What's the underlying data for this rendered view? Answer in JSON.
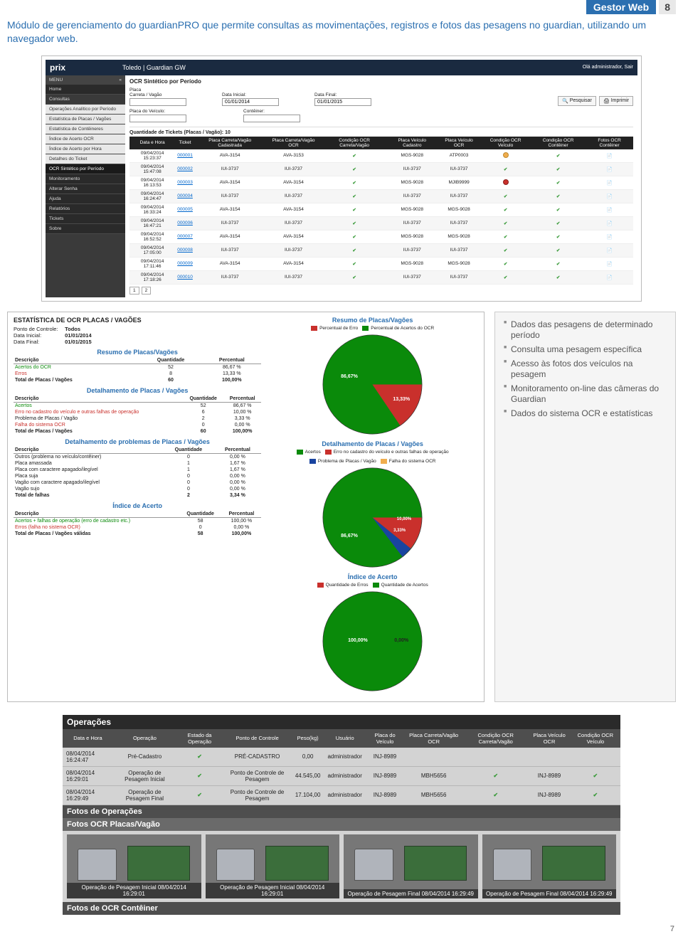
{
  "header": {
    "title": "Gestor Web",
    "page": "8"
  },
  "intro": "Módulo de gerenciamento do guardianPRO que permite consultas as movimentações, registros e fotos das pesagens no guardian, utilizando um navegador web.",
  "app": {
    "logo": "prix",
    "title": "Toledo | Guardian GW",
    "greeting": "Olá administrador, Sair",
    "menu_label": "MENU",
    "menu_collapse": "«",
    "sidebar": [
      "Home",
      "Consultas",
      "Operações Analítico por Período",
      "Estatística de Placas / Vagões",
      "Estatística de Contêineres",
      "Índice de Acerto OCR",
      "Índice de Acerto por Hora",
      "Detalhes do Ticket",
      "OCR Sintético por Período",
      "Monitoramento",
      "Alterar Senha",
      "Ajuda",
      "Relatórios",
      "Tickets",
      "Sobre"
    ],
    "main_title": "OCR Sintético por Período",
    "filters": {
      "f1_label": "Placa\nCarreta / Vagão",
      "f2_label": "Data Inicial:",
      "f2_value": "01/01/2014",
      "f3_label": "Data Final:",
      "f3_value": "01/01/2015",
      "f4_label": "Placa do Veículo:",
      "f5_label": "Contêiner:",
      "btn_search": "Pesquisar",
      "btn_print": "Imprimir"
    },
    "qty_line": "Quantidade de Tickets (Placas / Vagão): 10",
    "table": {
      "headers": [
        "Data e Hora",
        "Ticket",
        "Placa Carreta/Vagão Cadastrada",
        "Placa Carreta/Vagão OCR",
        "Condição OCR Carreta/Vagão",
        "Placa Veículo Cadastro",
        "Placa Veículo OCR",
        "Condição OCR Veículo",
        "Condição OCR Contêiner",
        "Fotos OCR Contêiner"
      ],
      "rows": [
        [
          "09/04/2014 15:23:37",
          "000001",
          "AVA-3154",
          "AVA-3153",
          "chk",
          "MGS-9028",
          "ATP0003",
          "warn",
          "chk",
          "doc"
        ],
        [
          "09/04/2014 15:47:08",
          "000002",
          "IUI-3737",
          "IUI-3737",
          "chk",
          "IUI-3737",
          "IUI-3737",
          "chk",
          "chk",
          "doc"
        ],
        [
          "09/04/2014 16:13:53",
          "000003",
          "AVA-3154",
          "AVA-3154",
          "chk",
          "MGS-9028",
          "MJIB9999",
          "err",
          "chk",
          "doc"
        ],
        [
          "09/04/2014 16:24:47",
          "000004",
          "IUI-3737",
          "IUI-3737",
          "chk",
          "IUI-3737",
          "IUI-3737",
          "chk",
          "chk",
          "doc"
        ],
        [
          "09/04/2014 16:33:24",
          "000005",
          "AVA-3154",
          "AVA-3154",
          "chk",
          "MGS-9028",
          "MGS-9028",
          "chk",
          "chk",
          "doc"
        ],
        [
          "09/04/2014 16:47:21",
          "000006",
          "IUI-3737",
          "IUI-3737",
          "chk",
          "IUI-3737",
          "IUI-3737",
          "chk",
          "chk",
          "doc"
        ],
        [
          "09/04/2014 16:52:52",
          "000007",
          "AVA-3154",
          "AVA-3154",
          "chk",
          "MGS-9028",
          "MGS-9028",
          "chk",
          "chk",
          "doc"
        ],
        [
          "09/04/2014 17:05:00",
          "000008",
          "IUI-3737",
          "IUI-3737",
          "chk",
          "IUI-3737",
          "IUI-3737",
          "chk",
          "chk",
          "doc"
        ],
        [
          "09/04/2014 17:11:46",
          "000009",
          "AVA-3154",
          "AVA-3154",
          "chk",
          "MGS-9028",
          "MGS-9028",
          "chk",
          "chk",
          "doc"
        ],
        [
          "09/04/2014 17:18:26",
          "000010",
          "IUI-3737",
          "IUI-3737",
          "chk",
          "IUI-3737",
          "IUI-3737",
          "chk",
          "chk",
          "doc"
        ]
      ]
    },
    "pager": [
      "1",
      "2"
    ]
  },
  "stats": {
    "title": "ESTATÍSTICA DE OCR PLACAS / VAGÕES",
    "meta": {
      "l1k": "Ponto de Controle:",
      "l1v": "Todos",
      "l2k": "Data Inicial:",
      "l2v": "01/01/2014",
      "l3k": "Data Final:",
      "l3v": "01/01/2015"
    },
    "sec1": {
      "title": "Resumo de Placas/Vagões",
      "cols": [
        "Descrição",
        "Quantidade",
        "Percentual"
      ],
      "rows": [
        {
          "d": "Acertos do OCR",
          "q": "52",
          "p": "86,67 %",
          "cls": "green"
        },
        {
          "d": "Erros",
          "q": "8",
          "p": "13,33 %",
          "cls": "red"
        },
        {
          "d": "Total de Placas / Vagões",
          "q": "60",
          "p": "100,00%",
          "cls": "bold"
        }
      ]
    },
    "sec2": {
      "title": "Detalhamento de Placas / Vagões",
      "cols": [
        "Descrição",
        "Quantidade",
        "Percentual"
      ],
      "rows": [
        {
          "d": "Acertos",
          "q": "52",
          "p": "86,67 %",
          "cls": "green"
        },
        {
          "d": "Erro no cadastro do veículo e outras falhas de operação",
          "q": "6",
          "p": "10,00 %",
          "cls": "red"
        },
        {
          "d": "Problema de Placas / Vagão",
          "q": "2",
          "p": "3,33 %",
          "cls": ""
        },
        {
          "d": "Falha do sistema OCR",
          "q": "0",
          "p": "0,00 %",
          "cls": "red"
        },
        {
          "d": "Total de Placas / Vagões",
          "q": "60",
          "p": "100,00%",
          "cls": "bold"
        }
      ]
    },
    "sec3": {
      "title": "Detalhamento de problemas de Placas / Vagões",
      "cols": [
        "Descrição",
        "Quantidade",
        "Percentual"
      ],
      "rows": [
        {
          "d": "Outros (problema no veículo/contêiner)",
          "q": "0",
          "p": "0,00 %",
          "cls": ""
        },
        {
          "d": "Placa amassada",
          "q": "1",
          "p": "1,67 %",
          "cls": ""
        },
        {
          "d": "Placa com caractere apagado/ilegível",
          "q": "1",
          "p": "1,67 %",
          "cls": ""
        },
        {
          "d": "Placa suja",
          "q": "0",
          "p": "0,00 %",
          "cls": ""
        },
        {
          "d": "Vagão com caractere apagado/ilegível",
          "q": "0",
          "p": "0,00 %",
          "cls": ""
        },
        {
          "d": "Vagão sujo",
          "q": "0",
          "p": "0,00 %",
          "cls": ""
        },
        {
          "d": "Total de falhas",
          "q": "2",
          "p": "3,34 %",
          "cls": "bold"
        }
      ]
    },
    "sec4": {
      "title": "Índice de Acerto",
      "cols": [
        "Descrição",
        "Quantidade",
        "Percentual"
      ],
      "rows": [
        {
          "d": "Acertos + falhas de operação (erro de cadastro etc.)",
          "q": "58",
          "p": "100,00 %",
          "cls": "green"
        },
        {
          "d": "Erros (falha no sistema OCR)",
          "q": "0",
          "p": "0,00 %",
          "cls": "red"
        },
        {
          "d": "Total de Placas / Vagões válidas",
          "q": "58",
          "p": "100,00%",
          "cls": "bold"
        }
      ]
    },
    "charts": {
      "c1": {
        "title": "Resumo de Placas/Vagões",
        "legend": [
          {
            "c": "#c9302c",
            "t": "Percentual de Erro"
          },
          {
            "c": "#0a8a0a",
            "t": "Percentual de Acertos do OCR"
          }
        ],
        "labels": [
          "86,67%",
          "13,33%"
        ]
      },
      "c2": {
        "title": "Detalhamento de Placas / Vagões",
        "legend": [
          {
            "c": "#0a8a0a",
            "t": "Acertos"
          },
          {
            "c": "#c9302c",
            "t": "Erro no cadastro do veículo e outras falhas de operação"
          },
          {
            "c": "#1944a0",
            "t": "Problema de Placas / Vagão"
          },
          {
            "c": "#f0ad4e",
            "t": "Falha do sistema OCR"
          }
        ],
        "labels": [
          "86,67%",
          "3,33%",
          "10,00%"
        ]
      },
      "c3": {
        "title": "Índice de Acerto",
        "legend": [
          {
            "c": "#c9302c",
            "t": "Quantidade de Erros"
          },
          {
            "c": "#0a8a0a",
            "t": "Quantidade de Acertos"
          }
        ],
        "labels": [
          "100,00%",
          "0,00%"
        ]
      }
    }
  },
  "features": [
    "Dados das pesagens de determinado período",
    "Consulta uma pesagem específica",
    "Acesso às fotos dos veículos na pesagem",
    "Monitoramento on-line das câmeras do Guardian",
    "Dados do sistema OCR e estatísticas"
  ],
  "ops": {
    "title": "Operações",
    "headers": [
      "Data e Hora",
      "Operação",
      "Estado da Operação",
      "Ponto de Controle",
      "Peso(kg)",
      "Usuário",
      "Placa do Veículo",
      "Placa Carreta/Vagão OCR",
      "Condição OCR Carreta/Vagão",
      "Placa Veículo OCR",
      "Condição OCR Veículo"
    ],
    "rows": [
      [
        "08/04/2014 16:24:47",
        "Pré-Cadastro",
        "chk",
        "PRÉ-CADASTRO",
        "0,00",
        "administrador",
        "INJ-8989",
        "",
        "",
        "",
        ""
      ],
      [
        "08/04/2014 16:29:01",
        "Operação de Pesagem Inicial",
        "chk",
        "Ponto de Controle de Pesagem",
        "44.545,00",
        "administrador",
        "INJ-8989",
        "MBH5656",
        "chk",
        "INJ-8989",
        "chk"
      ],
      [
        "08/04/2014 16:29:49",
        "Operação de Pesagem Final",
        "chk",
        "Ponto de Controle de Pesagem",
        "17.104,00",
        "administrador",
        "INJ-8989",
        "MBH5656",
        "chk",
        "INJ-8989",
        "chk"
      ]
    ],
    "foto_ops": "Fotos de Operações",
    "foto_pv": "Fotos OCR Placas/Vagão",
    "foto_ct": "Fotos de OCR Contêiner",
    "thumbs": [
      "Operação de Pesagem Inicial 08/04/2014 16:29:01",
      "Operação de Pesagem Inicial 08/04/2014 16:29:01",
      "Operação de Pesagem Final 08/04/2014 16:29:49",
      "Operação de Pesagem Final 08/04/2014 16:29:49"
    ]
  },
  "foot_page": "7",
  "chart_data": [
    {
      "type": "pie",
      "title": "Resumo de Placas/Vagões",
      "series": [
        {
          "name": "Percentual de Acertos do OCR",
          "value": 86.67
        },
        {
          "name": "Percentual de Erro",
          "value": 13.33
        }
      ]
    },
    {
      "type": "pie",
      "title": "Detalhamento de Placas / Vagões",
      "series": [
        {
          "name": "Acertos",
          "value": 86.67
        },
        {
          "name": "Erro no cadastro do veículo e outras falhas de operação",
          "value": 10.0
        },
        {
          "name": "Problema de Placas / Vagão",
          "value": 3.33
        },
        {
          "name": "Falha do sistema OCR",
          "value": 0.0
        }
      ]
    },
    {
      "type": "pie",
      "title": "Índice de Acerto",
      "series": [
        {
          "name": "Quantidade de Acertos",
          "value": 100.0
        },
        {
          "name": "Quantidade de Erros",
          "value": 0.0
        }
      ]
    }
  ]
}
